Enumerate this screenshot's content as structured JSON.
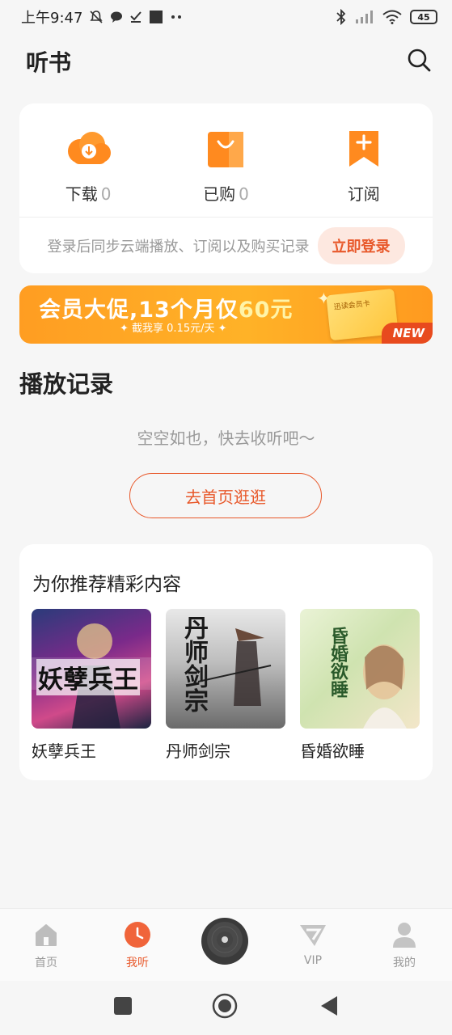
{
  "status_bar": {
    "time": "上午9:47",
    "battery": "45"
  },
  "header": {
    "title": "听书"
  },
  "quick_actions": [
    {
      "label": "下载",
      "count": "0",
      "icon": "download-cloud-icon"
    },
    {
      "label": "已购",
      "count": "0",
      "icon": "shopping-bag-icon"
    },
    {
      "label": "订阅",
      "count": "",
      "icon": "bookmark-plus-icon"
    }
  ],
  "login": {
    "hint": "登录后同步云端播放、订阅以及购买记录",
    "button": "立即登录"
  },
  "banner": {
    "title_prefix": "会员大促,13个月仅",
    "title_price": "60元",
    "subtitle": "✦ 截我享 0.15元/天 ✦",
    "card_text": "迅读会员卡",
    "badge": "NEW"
  },
  "history": {
    "title": "播放记录",
    "empty_text": "空空如也，快去收听吧～",
    "button": "去首页逛逛"
  },
  "recommend": {
    "title": "为你推荐精彩内容",
    "books": [
      {
        "name": "妖孽兵王",
        "cover_text": "妖孽兵王"
      },
      {
        "name": "丹师剑宗",
        "cover_text": "丹师剑宗"
      },
      {
        "name": "昏婚欲睡",
        "cover_text": "昏婚欲睡"
      }
    ]
  },
  "bottom_nav": {
    "items": [
      {
        "label": "首页",
        "icon": "home-icon",
        "active": false
      },
      {
        "label": "我听",
        "icon": "clock-icon",
        "active": true
      },
      {
        "label": "VIP",
        "icon": "vip-icon",
        "active": false
      },
      {
        "label": "我的",
        "icon": "user-icon",
        "active": false
      }
    ]
  },
  "colors": {
    "accent": "#e8582a",
    "icon_orange": "#ff8a1f",
    "background": "#f6f6f6"
  }
}
